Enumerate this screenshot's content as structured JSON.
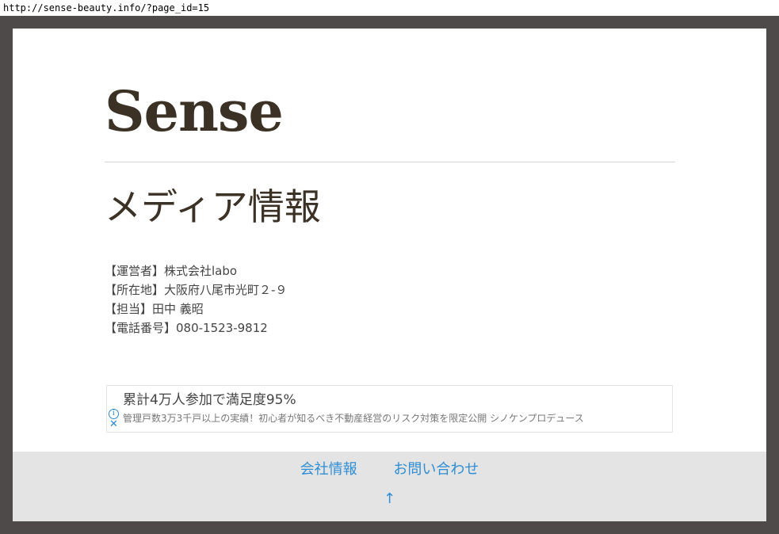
{
  "browser": {
    "url": "http://sense-beauty.info/?page_id=15"
  },
  "site": {
    "title": "Sense"
  },
  "page": {
    "heading": "メディア情報",
    "info_lines": [
      "【運営者】株式会社labo",
      "【所在地】大阪府八尾市光町２-９",
      "【担当】田中 義昭",
      "【電話番号】080-1523-9812"
    ]
  },
  "ad": {
    "headline": "累計4万人参加で満足度95%",
    "description": "管理戸数3万3千戸以上の実績！初心者が知るべき不動産経営のリスク対策を限定公開 シノケンプロデュース",
    "info_icon": "info-icon",
    "close_icon": "close-icon",
    "icon_color": "#2a8ad8"
  },
  "footer": {
    "links": [
      "会社情報",
      "お問い合わせ"
    ],
    "back_to_top": "↑"
  },
  "colors": {
    "frame": "#4e4a4a",
    "title": "#3b3125",
    "link": "#2e8ed6",
    "footer_bg": "#e4e4e4"
  }
}
